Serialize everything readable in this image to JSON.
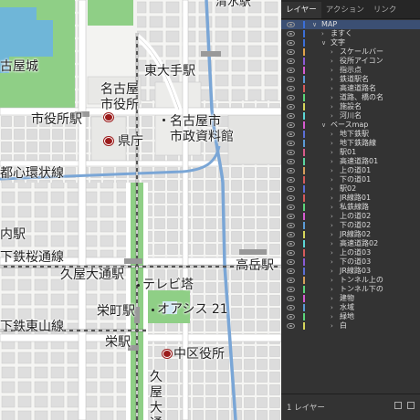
{
  "map": {
    "labels": [
      {
        "id": "shimizu-station",
        "text": "清水駅"
      },
      {
        "id": "nagoya-castle",
        "text": "古屋城"
      },
      {
        "id": "higashi-ote-station",
        "text": "東大手駅"
      },
      {
        "id": "nagoya-city-hall",
        "text": "名古屋\n市役所"
      },
      {
        "id": "shiyakusho-station",
        "text": "市役所駅"
      },
      {
        "id": "city-archives",
        "text": "名古屋市\n市政資料館"
      },
      {
        "id": "prefectural-office",
        "text": "県庁"
      },
      {
        "id": "toshin-kanjo-line",
        "text": "都心環状線"
      },
      {
        "id": "marunouchi-station",
        "text": "内駅"
      },
      {
        "id": "sakuradori-line",
        "text": "下鉄桜通線"
      },
      {
        "id": "hisaya-odori-station",
        "text": "久屋大通駅"
      },
      {
        "id": "tv-tower",
        "text": "テレビ塔"
      },
      {
        "id": "takaoka-station",
        "text": "高岳駅"
      },
      {
        "id": "sakaemachi-station",
        "text": "栄町駅"
      },
      {
        "id": "oasis21",
        "text": "オアシス 21"
      },
      {
        "id": "higashiyama-line",
        "text": "下鉄東山線"
      },
      {
        "id": "sakae-station",
        "text": "栄駅"
      },
      {
        "id": "naka-ward-office",
        "text": "中区役所"
      },
      {
        "id": "hisaya-odori",
        "text": "久屋大通"
      }
    ]
  },
  "panel": {
    "tabs": [
      "レイヤー",
      "アクション",
      "リンク"
    ],
    "footer_label": "1 レイヤー",
    "layers": [
      {
        "name": "MAP",
        "depth": 0,
        "open": true,
        "color": "#3b6fd8",
        "selected": true
      },
      {
        "name": "ますく",
        "depth": 1,
        "open": false,
        "color": "#3b6fd8"
      },
      {
        "name": "文字",
        "depth": 1,
        "open": true,
        "color": "#3b6fd8"
      },
      {
        "name": "スケールバー",
        "depth": 2,
        "open": false,
        "color": "#e0a34a"
      },
      {
        "name": "役所アイコン",
        "depth": 2,
        "open": false,
        "color": "#8a5bd6"
      },
      {
        "name": "指示点",
        "depth": 2,
        "open": false,
        "color": "#d65bd0"
      },
      {
        "name": "鉄道駅名",
        "depth": 2,
        "open": false,
        "color": "#5b9bd6"
      },
      {
        "name": "高速道路名",
        "depth": 2,
        "open": false,
        "color": "#d65b5b"
      },
      {
        "name": "道路、橋の名",
        "depth": 2,
        "open": false,
        "color": "#5bd67a"
      },
      {
        "name": "施設名",
        "depth": 2,
        "open": false,
        "color": "#d6d65b"
      },
      {
        "name": "河川名",
        "depth": 2,
        "open": false,
        "color": "#5bd6d6"
      },
      {
        "name": "ベースmap",
        "depth": 1,
        "open": true,
        "color": "#d65bd0"
      },
      {
        "name": "地下鉄駅",
        "depth": 2,
        "open": false,
        "color": "#5b6fd6"
      },
      {
        "name": "地下鉄路線",
        "depth": 2,
        "open": false,
        "color": "#5b9bd6"
      },
      {
        "name": "駅01",
        "depth": 2,
        "open": false,
        "color": "#d65b8a"
      },
      {
        "name": "高速道路01",
        "depth": 2,
        "open": false,
        "color": "#5bd6a0"
      },
      {
        "name": "上の道01",
        "depth": 2,
        "open": false,
        "color": "#d6a05b"
      },
      {
        "name": "下の道01",
        "depth": 2,
        "open": false,
        "color": "#d65b5b"
      },
      {
        "name": "駅02",
        "depth": 2,
        "open": false,
        "color": "#5b6fd6"
      },
      {
        "name": "JR線路01",
        "depth": 2,
        "open": false,
        "color": "#d65b5b"
      },
      {
        "name": "私鉄線路",
        "depth": 2,
        "open": false,
        "color": "#5bd67a"
      },
      {
        "name": "上の道02",
        "depth": 2,
        "open": false,
        "color": "#d65bd0"
      },
      {
        "name": "下の道02",
        "depth": 2,
        "open": false,
        "color": "#5b9bd6"
      },
      {
        "name": "JR線路02",
        "depth": 2,
        "open": false,
        "color": "#d6d65b"
      },
      {
        "name": "高速道路02",
        "depth": 2,
        "open": false,
        "color": "#5bd6d6"
      },
      {
        "name": "上の道03",
        "depth": 2,
        "open": false,
        "color": "#d65b5b"
      },
      {
        "name": "下の道03",
        "depth": 2,
        "open": false,
        "color": "#8a5bd6"
      },
      {
        "name": "JR線路03",
        "depth": 2,
        "open": false,
        "color": "#5b6fd6"
      },
      {
        "name": "トンネル上の",
        "depth": 2,
        "open": false,
        "color": "#d6a05b"
      },
      {
        "name": "トンネル下の",
        "depth": 2,
        "open": false,
        "color": "#5bd67a"
      },
      {
        "name": "建物",
        "depth": 2,
        "open": false,
        "color": "#d65bd0"
      },
      {
        "name": "水域",
        "depth": 2,
        "open": false,
        "color": "#5b9bd6"
      },
      {
        "name": "緑地",
        "depth": 2,
        "open": false,
        "color": "#5bd67a"
      },
      {
        "name": "白",
        "depth": 2,
        "open": false,
        "color": "#d6d65b"
      }
    ]
  }
}
